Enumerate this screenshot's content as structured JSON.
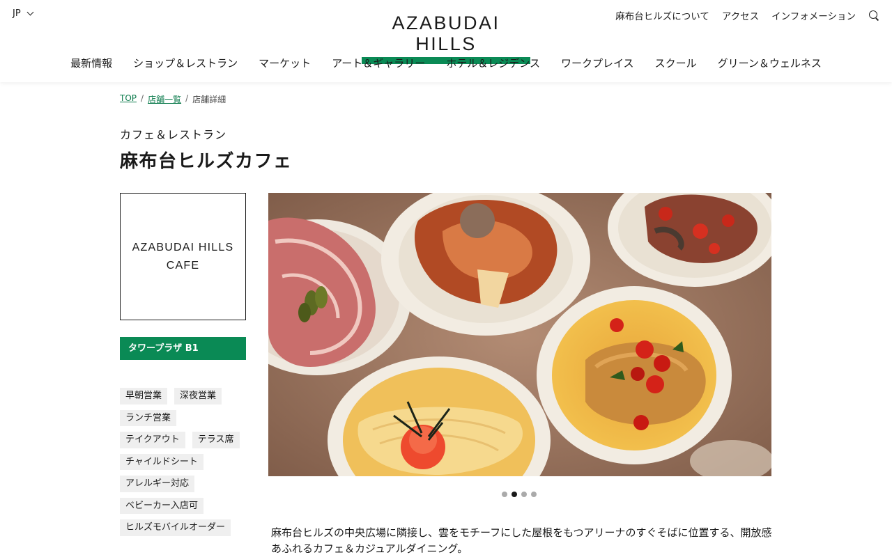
{
  "header": {
    "lang": "JP",
    "logo_text": "AZABUDAI HILLS",
    "util_links": [
      "麻布台ヒルズについて",
      "アクセス",
      "インフォメーション"
    ]
  },
  "nav": [
    "最新情報",
    "ショップ＆レストラン",
    "マーケット",
    "アート＆ギャラリー",
    "ホテル＆レジデンス",
    "ワークプレイス",
    "スクール",
    "グリーン＆ウェルネス"
  ],
  "breadcrumb": {
    "top": "TOP",
    "list": "店舗一覧",
    "current": "店舗詳細"
  },
  "shop": {
    "category": "カフェ＆レストラン",
    "title": "麻布台ヒルズカフェ",
    "logo_line1": "AZABUDAI HILLS",
    "logo_line2": "CAFE",
    "floor": "タワープラザ B1",
    "tags": [
      "早朝営業",
      "深夜営業",
      "ランチ営業",
      "テイクアウト",
      "テラス席",
      "チャイルドシート",
      "アレルギー対応",
      "ベビーカー入店可",
      "ヒルズモバイルオーダー"
    ],
    "description": "麻布台ヒルズの中央広場に隣接し、雲をモチーフにした屋根をもつアリーナのすぐそばに位置する、開放感あふれるカフェ＆カジュアルダイニング。"
  },
  "carousel": {
    "slides": 4,
    "active_index": 1
  },
  "colors": {
    "brand_green": "#0a8a55",
    "link_green": "#0a7a4b"
  }
}
